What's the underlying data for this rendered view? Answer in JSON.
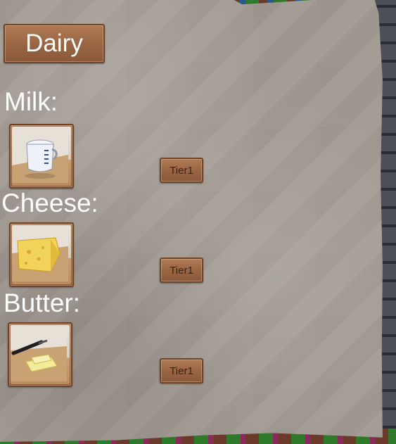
{
  "panel": {
    "title": "Dairy"
  },
  "items": [
    {
      "label": "Milk:",
      "icon": "milk-jug-icon",
      "tier_label": "Tier1"
    },
    {
      "label": "Cheese:",
      "icon": "cheese-icon",
      "tier_label": "Tier1"
    },
    {
      "label": "Butter:",
      "icon": "butter-icon",
      "tier_label": "Tier1"
    }
  ],
  "colors": {
    "paper": "#a49d96",
    "wood": "#9a6644",
    "text": "#ffffff"
  }
}
